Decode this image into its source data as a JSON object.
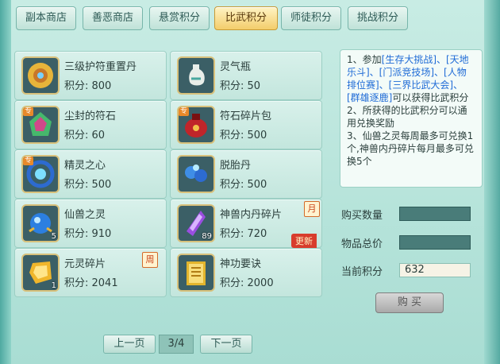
{
  "tabs": [
    {
      "label": "副本商店"
    },
    {
      "label": "善恶商店"
    },
    {
      "label": "悬赏积分"
    },
    {
      "label": "比武积分"
    },
    {
      "label": "师徒积分"
    },
    {
      "label": "挑战积分"
    }
  ],
  "price_prefix": "积分:",
  "items": [
    {
      "name": "三级护符重置丹",
      "price": "积分: 800",
      "icon": "golden-amulet-pill-icon"
    },
    {
      "name": "灵气瓶",
      "price": "积分: 50",
      "icon": "spirit-vase-icon"
    },
    {
      "name": "尘封的符石",
      "price": "积分: 60",
      "icon": "sealed-rune-stone-icon",
      "badge": "专"
    },
    {
      "name": "符石碎片包",
      "price": "积分: 500",
      "icon": "rune-shard-bag-icon",
      "badge": "专"
    },
    {
      "name": "精灵之心",
      "price": "积分: 500",
      "icon": "spirit-heart-icon",
      "badge": "专"
    },
    {
      "name": "脱胎丹",
      "price": "积分: 500",
      "icon": "rebirth-pill-icon"
    },
    {
      "name": "仙兽之灵",
      "price": "积分: 910",
      "icon": "beast-spirit-orb-icon",
      "count": "5"
    },
    {
      "name": "神兽内丹碎片",
      "price": "积分: 720",
      "icon": "divine-beast-core-shard-icon",
      "count": "89",
      "tag": "月",
      "new_label": "更新"
    },
    {
      "name": "元灵碎片",
      "price": "积分: 2041",
      "icon": "yuanling-shard-icon",
      "count": "1",
      "tag": "周"
    },
    {
      "name": "神功要诀",
      "price": "积分: 2000",
      "icon": "skill-manual-book-icon"
    }
  ],
  "info": {
    "line1_prefix": "1、参加",
    "line1_events": "[生存大挑战]、[天地乐斗]、[门派竞技场]、[人物排位赛]、[三界比武大会]、[群雄逐鹿]",
    "line1_suffix": "可以获得比武积分",
    "line2": "2、所获得的比武积分可以通用兑换奖励",
    "line3": "3、仙兽之灵每周最多可兑换1个,神兽内丹碎片每月最多可兑换5个"
  },
  "form": {
    "qty_label": "购买数量",
    "qty_value": "",
    "total_label": "物品总价",
    "total_value": "",
    "points_label": "当前积分",
    "points_value": "632",
    "buy_label": "购 买"
  },
  "pager": {
    "prev": "上一页",
    "page": "3/4",
    "next": "下一页"
  },
  "colors": {
    "accent_tab": "#f3cd6b",
    "link_blue": "#1f6bd6",
    "new_red": "#d83c2d"
  }
}
